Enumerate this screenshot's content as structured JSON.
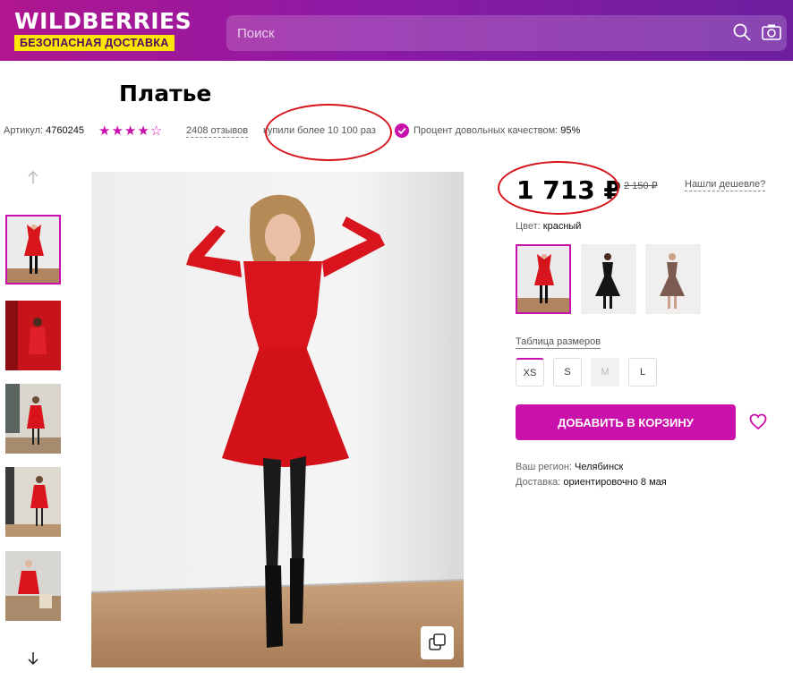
{
  "header": {
    "logo_text": "WILDBERRIES",
    "logo_badge": "БЕЗОПАСНАЯ ДОСТАВКА",
    "search_placeholder": "Поиск",
    "search_icon": "search-icon",
    "camera_icon": "camera-icon"
  },
  "product": {
    "title": "Платье",
    "article_label": "Артикул:",
    "article_value": "4760245",
    "rating_stars": 4,
    "rating_max": 5,
    "reviews": "2408 отзывов",
    "bought": "купили более 10 100 раз",
    "quality_label": "Процент довольных качеством:",
    "quality_value": "95%"
  },
  "gallery": {
    "arrow_up_icon": "arrow-up-icon",
    "arrow_down_icon": "arrow-down-icon",
    "zoom_icon": "copy-zoom-icon",
    "thumbnails_count": 5,
    "active_thumbnail": 1
  },
  "pricing": {
    "price": "1 713 ₽",
    "old_price": "2 150 ₽",
    "cheaper_link": "Нашли дешевле?"
  },
  "color": {
    "label": "Цвет:",
    "value": "красный",
    "options": [
      "красный",
      "черный",
      "коричневый"
    ]
  },
  "sizes": {
    "table_link": "Таблица размеров",
    "options": [
      "XS",
      "S",
      "M",
      "L"
    ],
    "selected": "XS",
    "disabled": [
      "M"
    ]
  },
  "cart": {
    "add_label": "ДОБАВИТЬ В КОРЗИНУ",
    "favorite_icon": "heart-icon"
  },
  "delivery": {
    "region_label": "Ваш регион:",
    "region_value": "Челябинск",
    "delivery_label": "Доставка:",
    "delivery_value": "ориентировочно 8 мая"
  },
  "colors": {
    "accent": "#cb11ab",
    "header_start": "#b0168f",
    "header_end": "#6d1fa0",
    "badge": "#ffe600",
    "annotation": "#d6141b"
  }
}
